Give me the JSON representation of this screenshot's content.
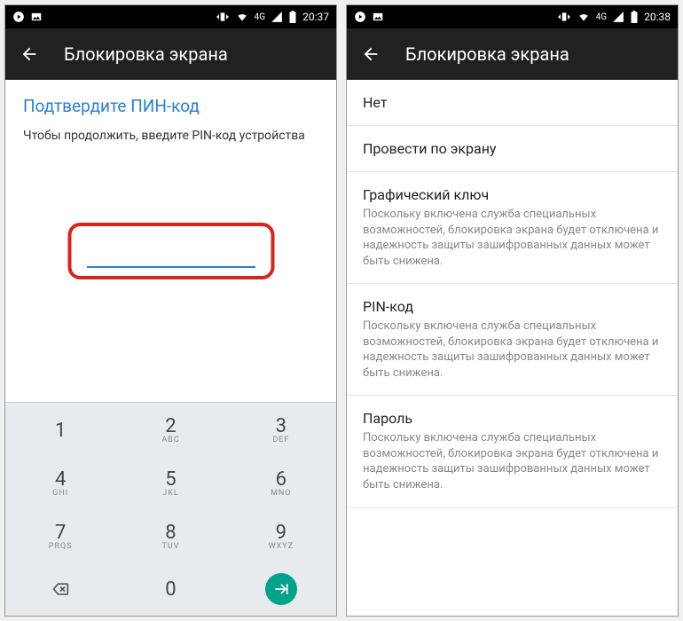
{
  "left": {
    "statusbar": {
      "time": "20:37",
      "net": "4G"
    },
    "appbar": {
      "title": "Блокировка экрана"
    },
    "pin": {
      "title": "Подтвердите ПИН-код",
      "subtitle": "Чтобы продолжить, введите PIN-код устройства",
      "value": ""
    },
    "keypad": {
      "keys": [
        [
          {
            "n": "1",
            "l": ""
          },
          {
            "n": "2",
            "l": "ABC"
          },
          {
            "n": "3",
            "l": "DEF"
          }
        ],
        [
          {
            "n": "4",
            "l": "GHI"
          },
          {
            "n": "5",
            "l": "JKL"
          },
          {
            "n": "6",
            "l": "MNO"
          }
        ],
        [
          {
            "n": "7",
            "l": "PRQS"
          },
          {
            "n": "8",
            "l": "TUV"
          },
          {
            "n": "9",
            "l": "WXYZ"
          }
        ]
      ],
      "zero": "0"
    }
  },
  "right": {
    "statusbar": {
      "time": "20:38",
      "net": "4G"
    },
    "appbar": {
      "title": "Блокировка экрана"
    },
    "options": [
      {
        "title": "Нет",
        "sub": ""
      },
      {
        "title": "Провести по экрану",
        "sub": ""
      },
      {
        "title": "Графический ключ",
        "sub": "Поскольку включена служба специальных возможностей, блокировка экрана будет отключена и надежность защиты зашифрованных данных может быть снижена."
      },
      {
        "title": "PIN-код",
        "sub": "Поскольку включена служба специальных возможностей, блокировка экрана будет отключена и надежность защиты зашифрованных данных может быть снижена."
      },
      {
        "title": "Пароль",
        "sub": "Поскольку включена служба специальных возможностей, блокировка экрана будет отключена и надежность защиты зашифрованных данных может быть снижена."
      }
    ]
  }
}
